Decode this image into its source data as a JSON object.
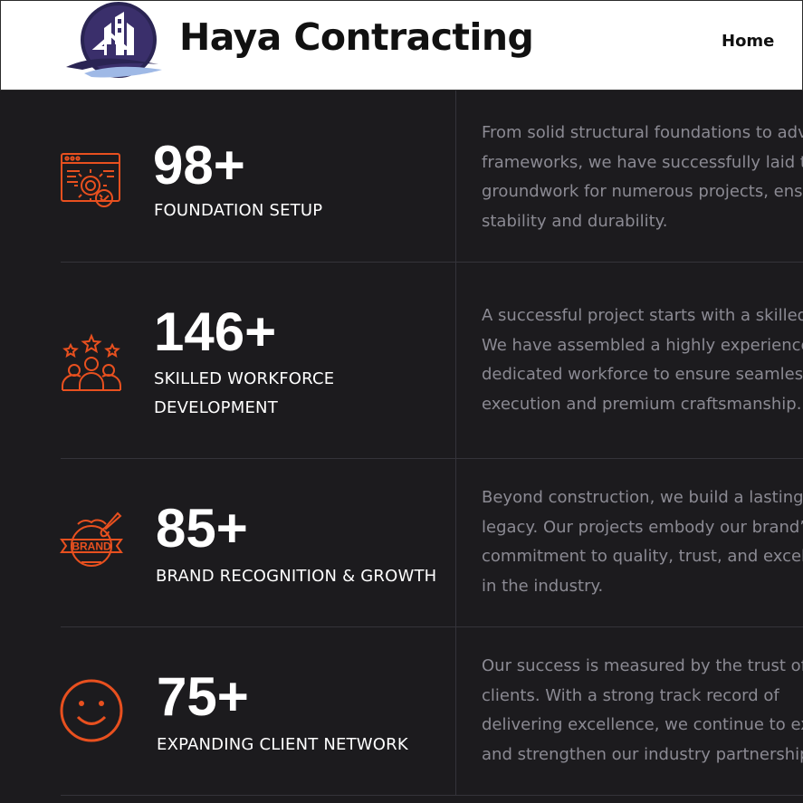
{
  "header": {
    "brand": "Haya Contracting",
    "nav": {
      "home": "Home"
    }
  },
  "colors": {
    "accent": "#e8501f",
    "background": "#1c1b1e",
    "muted_text": "#8b8a93"
  },
  "stats": [
    {
      "icon": "gear-check-icon",
      "number": "98+",
      "label_lines": [
        "FOUNDATION SETUP"
      ],
      "description_lines": [
        "From solid structural foundations to adva",
        "frameworks, we have successfully laid th",
        "groundwork for numerous projects, ensu",
        "stability and durability."
      ]
    },
    {
      "icon": "team-stars-icon",
      "number": "146+",
      "label_lines": [
        "SKILLED WORKFORCE",
        "DEVELOPMENT"
      ],
      "description_lines": [
        "A successful project starts with a skilled",
        "We have assembled a highly experience",
        "dedicated workforce to ensure seamless",
        "execution and premium craftsmanship."
      ]
    },
    {
      "icon": "brand-badge-icon",
      "number": "85+",
      "label_lines": [
        "BRAND RECOGNITION & GROWTH"
      ],
      "description_lines": [
        "Beyond construction, we build a lasting",
        "legacy. Our projects embody our brand’s",
        "commitment to quality, trust, and excelle",
        "in the industry."
      ]
    },
    {
      "icon": "smiley-icon",
      "number": "75+",
      "label_lines": [
        "EXPANDING CLIENT NETWORK"
      ],
      "description_lines": [
        "Our success is measured by the trust of",
        "clients. With a strong track record of",
        "delivering excellence, we continue to exp",
        "and strengthen our industry partnerships"
      ]
    }
  ],
  "icon_badge_text": "BRAND"
}
